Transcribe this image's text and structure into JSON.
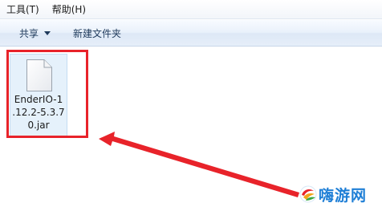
{
  "menubar": {
    "items": [
      {
        "label": "工具(T)"
      },
      {
        "label": "帮助(H)"
      }
    ]
  },
  "toolbar": {
    "share_label": "共享",
    "new_folder_label": "新建文件夹"
  },
  "file": {
    "name_lines": [
      "EnderIO-1",
      ".12.2-5.3.7",
      "0.jar"
    ],
    "icon": "generic-file-icon"
  },
  "annotation": {
    "highlight_color": "#e8232a",
    "arrow_color": "#e8232a"
  },
  "watermark": {
    "text": "嗨游网",
    "color": "#1f7fd6"
  }
}
